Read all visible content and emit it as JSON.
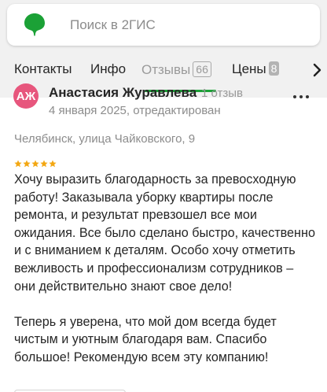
{
  "search": {
    "placeholder": "Поиск в 2ГИС"
  },
  "tabs": [
    {
      "label": "Контакты",
      "count": ""
    },
    {
      "label": "Инфо",
      "count": ""
    },
    {
      "label": "Отзывы",
      "count": "66",
      "active": true
    },
    {
      "label": "Цены",
      "count": "8"
    }
  ],
  "review": {
    "avatar_initials": "АЖ",
    "avatar_color": "#e7567d",
    "author": "Анастасия Журавлева",
    "author_reviews": "1 отзыв",
    "date": "4 января 2025, отредактирован",
    "address": "Челябинск, улица Чайковского, 9",
    "rating": 5,
    "paragraphs": [
      "Хочу выразить благодарность за превосходную работу! Заказывала уборку квартиры после ремонта, и результат превзошел все мои ожидания. Все было сделано быстро, качественно и с вниманием к деталям. Особо хочу отметить вежливость и профессионализм сотрудников – они действительно знают свое дело!",
      "Теперь я уверена, что мой дом всегда будет чистым и уютным благодаря вам. Спасибо большое! Рекомендую всем эту компанию!"
    ]
  },
  "colors": {
    "brand_green": "#1ba136",
    "star_color": "#f3a712",
    "header_bg": "#f1f1f1"
  },
  "icons": {
    "logo": "2gis-logo-icon",
    "menu": "more-dots-icon",
    "scroll": "chevron-right-icon",
    "star": "star-icon"
  }
}
